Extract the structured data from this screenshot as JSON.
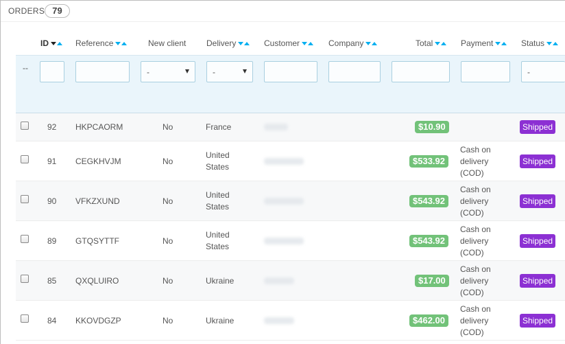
{
  "panel": {
    "title": "ORDERS",
    "count": "79"
  },
  "columns": {
    "id": "ID",
    "reference": "Reference",
    "new_client": "New client",
    "delivery": "Delivery",
    "customer": "Customer",
    "company": "Company",
    "total": "Total",
    "payment": "Payment",
    "status": "Status"
  },
  "filters": {
    "bulk_dash": "--",
    "new_client_selected": "-",
    "delivery_selected": "-",
    "status_selected": "-"
  },
  "colors": {
    "accent": "#00aff0",
    "total_badge": "#72c279",
    "status_badge": "#8c30d3",
    "filter_band": "#eaf5fb"
  },
  "rows": [
    {
      "id": "92",
      "reference": "HKPCAORM",
      "new_client": "No",
      "delivery_l1": "France",
      "delivery_l2": "",
      "total": "$10.90",
      "pay_l1": "",
      "pay_l2": "",
      "pay_l3": "",
      "status": "Shipped"
    },
    {
      "id": "91",
      "reference": "CEGKHVJM",
      "new_client": "No",
      "delivery_l1": "United",
      "delivery_l2": "States",
      "total": "$533.92",
      "pay_l1": "Cash on",
      "pay_l2": "delivery",
      "pay_l3": "(COD)",
      "status": "Shipped"
    },
    {
      "id": "90",
      "reference": "VFKZXUND",
      "new_client": "No",
      "delivery_l1": "United",
      "delivery_l2": "States",
      "total": "$543.92",
      "pay_l1": "Cash on",
      "pay_l2": "delivery",
      "pay_l3": "(COD)",
      "status": "Shipped"
    },
    {
      "id": "89",
      "reference": "GTQSYTTF",
      "new_client": "No",
      "delivery_l1": "United",
      "delivery_l2": "States",
      "total": "$543.92",
      "pay_l1": "Cash on",
      "pay_l2": "delivery",
      "pay_l3": "(COD)",
      "status": "Shipped"
    },
    {
      "id": "85",
      "reference": "QXQLUIRO",
      "new_client": "No",
      "delivery_l1": "Ukraine",
      "delivery_l2": "",
      "total": "$17.00",
      "pay_l1": "Cash on",
      "pay_l2": "delivery",
      "pay_l3": "(COD)",
      "status": "Shipped"
    },
    {
      "id": "84",
      "reference": "KKOVDGZP",
      "new_client": "No",
      "delivery_l1": "Ukraine",
      "delivery_l2": "",
      "total": "$462.00",
      "pay_l1": "Cash on",
      "pay_l2": "delivery",
      "pay_l3": "(COD)",
      "status": "Shipped"
    }
  ]
}
